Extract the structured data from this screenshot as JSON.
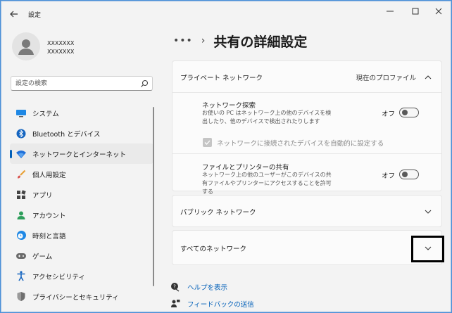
{
  "app": {
    "title": "設定"
  },
  "profile": {
    "name_line1": "XXXXXXX",
    "name_line2": "XXXXXXX"
  },
  "search": {
    "placeholder": "設定の検索"
  },
  "sidebar": {
    "items": [
      {
        "label": "システム",
        "icon": "monitor-icon",
        "active": false
      },
      {
        "label": "Bluetooth とデバイス",
        "icon": "bluetooth-icon",
        "active": false
      },
      {
        "label": "ネットワークとインターネット",
        "icon": "wifi-icon",
        "active": true
      },
      {
        "label": "個人用設定",
        "icon": "paintbrush-icon",
        "active": false
      },
      {
        "label": "アプリ",
        "icon": "apps-icon",
        "active": false
      },
      {
        "label": "アカウント",
        "icon": "person-icon",
        "active": false
      },
      {
        "label": "時刻と言語",
        "icon": "clock-globe-icon",
        "active": false
      },
      {
        "label": "ゲーム",
        "icon": "gamepad-icon",
        "active": false
      },
      {
        "label": "アクセシビリティ",
        "icon": "accessibility-icon",
        "active": false
      },
      {
        "label": "プライバシーとセキュリティ",
        "icon": "shield-icon",
        "active": false
      }
    ]
  },
  "breadcrumb": {
    "more": "•••",
    "separator": "›",
    "title": "共有の詳細設定"
  },
  "private_network": {
    "title": "プライベート ネットワーク",
    "status": "現在のプロファイル",
    "discovery": {
      "title": "ネットワーク探索",
      "description": "お使いの PC はネットワーク上の他のデバイスを検出したり、他のデバイスで検出されたりします",
      "state": "オフ"
    },
    "auto_setup": {
      "label": "ネットワークに接続されたデバイスを自動的に設定する",
      "checked": true
    },
    "file_sharing": {
      "title": "ファイルとプリンターの共有",
      "description": "ネットワーク上の他のユーザーがこのデバイスの共有ファイルやプリンターにアクセスすることを許可する",
      "state": "オフ"
    }
  },
  "public_network": {
    "title": "パブリック ネットワーク"
  },
  "all_networks": {
    "title": "すべてのネットワーク"
  },
  "help_links": {
    "help": "ヘルプを表示",
    "feedback": "フィードバックの送信"
  },
  "colors": {
    "accent": "#005fb8",
    "window_bg": "#f3f3f3",
    "card_bg": "#fbfbfb",
    "highlight": "#000000"
  }
}
